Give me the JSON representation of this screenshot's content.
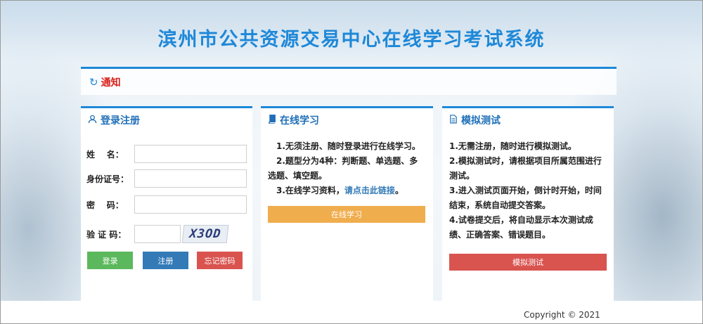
{
  "title": "滨州市公共资源交易中心在线学习考试系统",
  "notice": {
    "label": "通知",
    "icon": "refresh-circle-icon"
  },
  "login": {
    "title": "登录注册",
    "icon": "user-icon",
    "fields": [
      {
        "label": "姓    名：",
        "value": ""
      },
      {
        "label": "身份证号：",
        "value": ""
      },
      {
        "label": "密    码：",
        "value": ""
      },
      {
        "label": "验 证 码：",
        "value": ""
      }
    ],
    "captcha_text": "X3OD",
    "buttons": {
      "login": "登录",
      "register": "注册",
      "forgot": "忘记密码"
    }
  },
  "study": {
    "title": "在线学习",
    "icon": "book-icon",
    "items": [
      "1.无须注册、随时登录进行在线学习。",
      "2.题型分为4种：判断题、单选题、多选题、填空题。"
    ],
    "item3_prefix": "3.在线学习资料，",
    "item3_link": "请点击此链接",
    "item3_suffix": "。",
    "button": "在线学习"
  },
  "exam": {
    "title": "模拟测试",
    "icon": "document-icon",
    "items": [
      "1.无需注册，随时进行模拟测试。",
      "2.模拟测试时，请根据项目所属范围进行测试。",
      "3.进入测试页面开始，倒计时开始，时间结束，系统自动提交答案。",
      "4.试卷提交后，将自动显示本次测试成绩、正确答案、错误题目。"
    ],
    "button": "模拟测试"
  },
  "footer": {
    "copyright": "Copyright © 2021"
  },
  "colors": {
    "primary": "#1e88d8",
    "notice_red": "#d9211b",
    "btn_green": "#5cb85c",
    "btn_blue": "#337ab7",
    "btn_red": "#d9534f",
    "btn_orange": "#f0ad4e"
  }
}
